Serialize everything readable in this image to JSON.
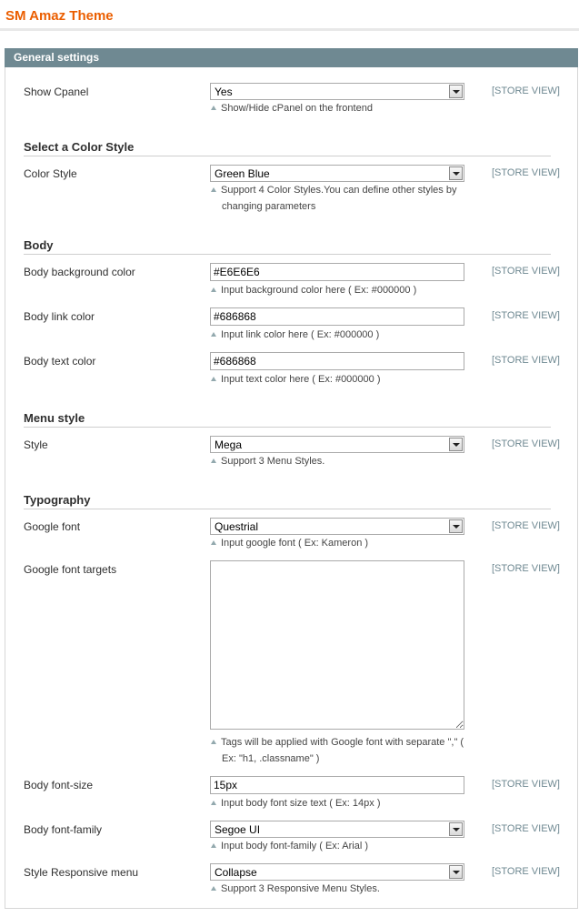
{
  "page": {
    "title": "SM Amaz Theme"
  },
  "panel": {
    "title": "General settings"
  },
  "scope_label": "[STORE VIEW]",
  "rows": {
    "show_cpanel": {
      "label": "Show Cpanel",
      "value": "Yes",
      "note": "Show/Hide cPanel on the frontend"
    },
    "color_style": {
      "label": "Color Style",
      "value": "Green Blue",
      "note": "Support 4 Color Styles.You can define other styles by changing parameters"
    },
    "body_bg": {
      "label": "Body background color",
      "value": "#E6E6E6",
      "note": "Input background color here ( Ex: #000000 )"
    },
    "body_link": {
      "label": "Body link color",
      "value": "#686868",
      "note": "Input link color here ( Ex: #000000 )"
    },
    "body_text": {
      "label": "Body text color",
      "value": "#686868",
      "note": "Input text color here ( Ex: #000000 )"
    },
    "menu_style": {
      "label": "Style",
      "value": "Mega",
      "note": "Support 3 Menu Styles."
    },
    "google_font": {
      "label": "Google font",
      "value": "Questrial",
      "note": "Input google font ( Ex: Kameron )"
    },
    "google_targets": {
      "label": "Google font targets",
      "value": "",
      "note": "Tags will be applied with Google font with separate \",\" ( Ex: \"h1, .classname\" )"
    },
    "body_font_size": {
      "label": "Body font-size",
      "value": "15px",
      "note": "Input body font size text ( Ex: 14px )"
    },
    "body_font_family": {
      "label": "Body font-family",
      "value": "Segoe UI",
      "note": "Input body font-family ( Ex: Arial )"
    },
    "responsive_menu": {
      "label": "Style Responsive menu",
      "value": "Collapse",
      "note": "Support 3 Responsive Menu Styles."
    }
  },
  "sections": {
    "color": "Select a Color Style",
    "body": "Body",
    "menu": "Menu style",
    "typography": "Typography"
  },
  "colors": {
    "title": "#eb5e00",
    "panel_header": "#6f8992",
    "scope": "#6f8992"
  }
}
